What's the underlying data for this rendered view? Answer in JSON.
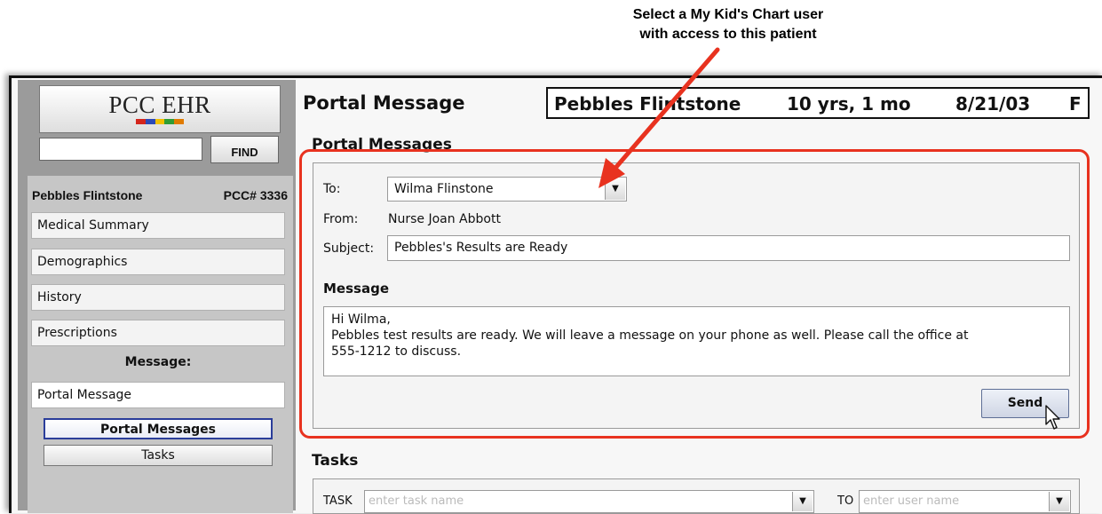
{
  "annotation": {
    "line1": "Select a My Kid's Chart user",
    "line2": "with access to this patient"
  },
  "logo": {
    "text": "PCC EHR",
    "bar_colors": [
      "#d4251c",
      "#2a49b8",
      "#f0c000",
      "#2f9d35",
      "#e07b00"
    ]
  },
  "find": {
    "button": "FIND",
    "value": ""
  },
  "patient_sidebar": {
    "name": "Pebbles Flintstone",
    "pcc": "PCC# 3336"
  },
  "nav": {
    "items": [
      {
        "label": "Medical Summary"
      },
      {
        "label": "Demographics"
      },
      {
        "label": "History"
      },
      {
        "label": "Prescriptions"
      }
    ],
    "message_header": "Message:",
    "portal_message": "Portal Message",
    "sub": [
      {
        "label": "Portal Messages",
        "active": true
      },
      {
        "label": "Tasks",
        "active": false
      }
    ]
  },
  "header": {
    "title": "Portal Message",
    "patient": {
      "name": "Pebbles Flintstone",
      "age": "10 yrs, 1 mo",
      "dob": "8/21/03",
      "sex": "F"
    }
  },
  "portal": {
    "section": "Portal Messages",
    "to_label": "To:",
    "to_value": "Wilma Flinstone",
    "from_label": "From:",
    "from_value": "Nurse Joan Abbott",
    "subject_label": "Subject:",
    "subject_value": "Pebbles's Results are Ready",
    "message_label": "Message",
    "message_line1": "Hi Wilma,",
    "message_line2": "Pebbles test results are ready. We will leave a message on your phone as well. Please call the office at",
    "message_line3": "555-1212 to discuss.",
    "send": "Send"
  },
  "tasks": {
    "section": "Tasks",
    "task_label": "TASK",
    "task_placeholder": "enter task name",
    "to_label": "TO",
    "to_placeholder": "enter user name"
  },
  "colors": {
    "highlight": "#e8321f",
    "arrow": "#e8321f",
    "active_border": "#2a3d9a",
    "sidebar_bg": "#9b9b9b"
  }
}
